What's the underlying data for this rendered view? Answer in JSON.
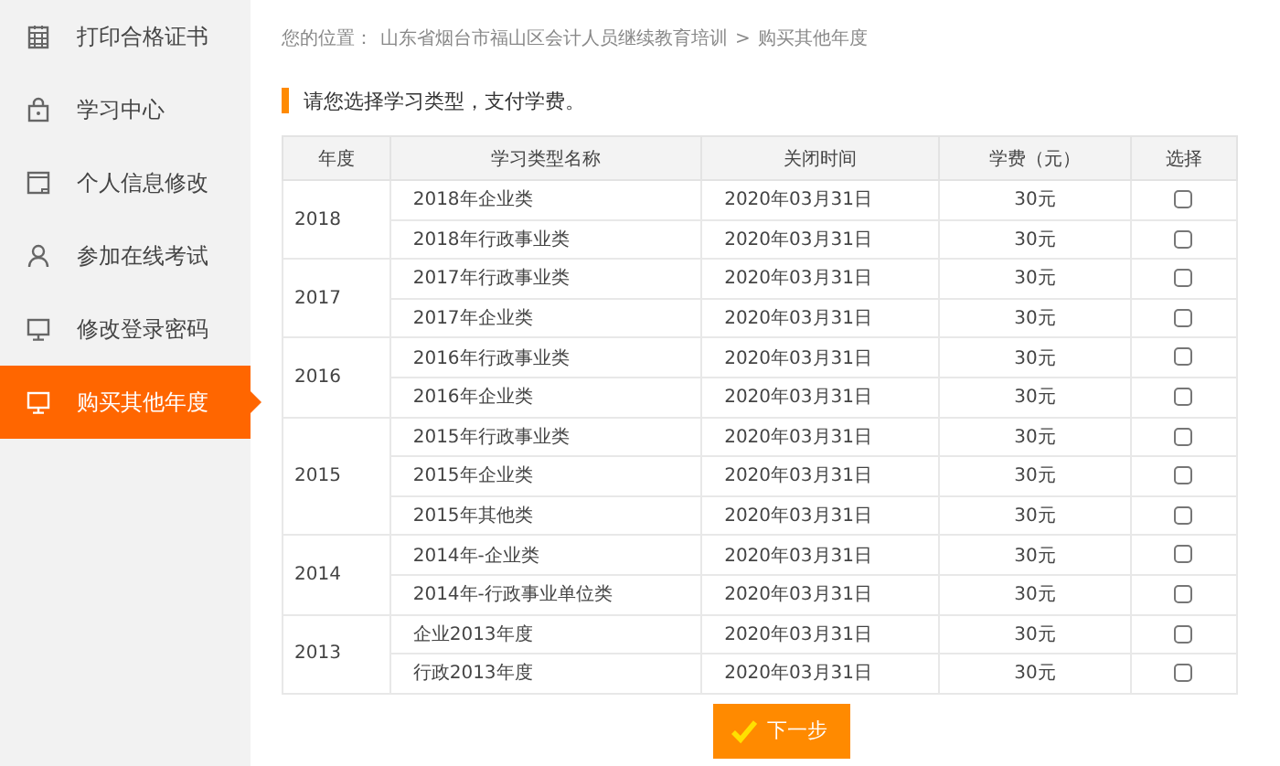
{
  "sidebar": {
    "items": [
      {
        "label": "打印合格证书",
        "selected": false
      },
      {
        "label": "学习中心",
        "selected": false
      },
      {
        "label": "个人信息修改",
        "selected": false
      },
      {
        "label": "参加在线考试",
        "selected": false
      },
      {
        "label": "修改登录密码",
        "selected": false
      },
      {
        "label": "购买其他年度",
        "selected": true
      }
    ]
  },
  "breadcrumb": {
    "prefix": "您的位置：",
    "path": "山东省烟台市福山区会计人员继续教育培训",
    "separator": ">",
    "current": "购买其他年度"
  },
  "heading": "请您选择学习类型，支付学费。",
  "table": {
    "columns": [
      "年度",
      "学习类型名称",
      "关闭时间",
      "学费（元）",
      "选择"
    ],
    "groups": [
      {
        "year": "2018",
        "rows": [
          {
            "name": "2018年企业类",
            "close": "2020年03月31日",
            "fee": "30元",
            "checked": false
          },
          {
            "name": "2018年行政事业类",
            "close": "2020年03月31日",
            "fee": "30元",
            "checked": false
          }
        ]
      },
      {
        "year": "2017",
        "rows": [
          {
            "name": "2017年行政事业类",
            "close": "2020年03月31日",
            "fee": "30元",
            "checked": false
          },
          {
            "name": "2017年企业类",
            "close": "2020年03月31日",
            "fee": "30元",
            "checked": false
          }
        ]
      },
      {
        "year": "2016",
        "rows": [
          {
            "name": "2016年行政事业类",
            "close": "2020年03月31日",
            "fee": "30元",
            "checked": false
          },
          {
            "name": "2016年企业类",
            "close": "2020年03月31日",
            "fee": "30元",
            "checked": false
          }
        ]
      },
      {
        "year": "2015",
        "rows": [
          {
            "name": "2015年行政事业类",
            "close": "2020年03月31日",
            "fee": "30元",
            "checked": false
          },
          {
            "name": "2015年企业类",
            "close": "2020年03月31日",
            "fee": "30元",
            "checked": false
          },
          {
            "name": "2015年其他类",
            "close": "2020年03月31日",
            "fee": "30元",
            "checked": false
          }
        ]
      },
      {
        "year": "2014",
        "rows": [
          {
            "name": "2014年-企业类",
            "close": "2020年03月31日",
            "fee": "30元",
            "checked": false
          },
          {
            "name": "2014年-行政事业单位类",
            "close": "2020年03月31日",
            "fee": "30元",
            "checked": false
          }
        ]
      },
      {
        "year": "2013",
        "rows": [
          {
            "name": "企业2013年度",
            "close": "2020年03月31日",
            "fee": "30元",
            "checked": false
          },
          {
            "name": "行政2013年度",
            "close": "2020年03月31日",
            "fee": "30元",
            "checked": false
          }
        ]
      }
    ]
  },
  "next_button": "下一步"
}
